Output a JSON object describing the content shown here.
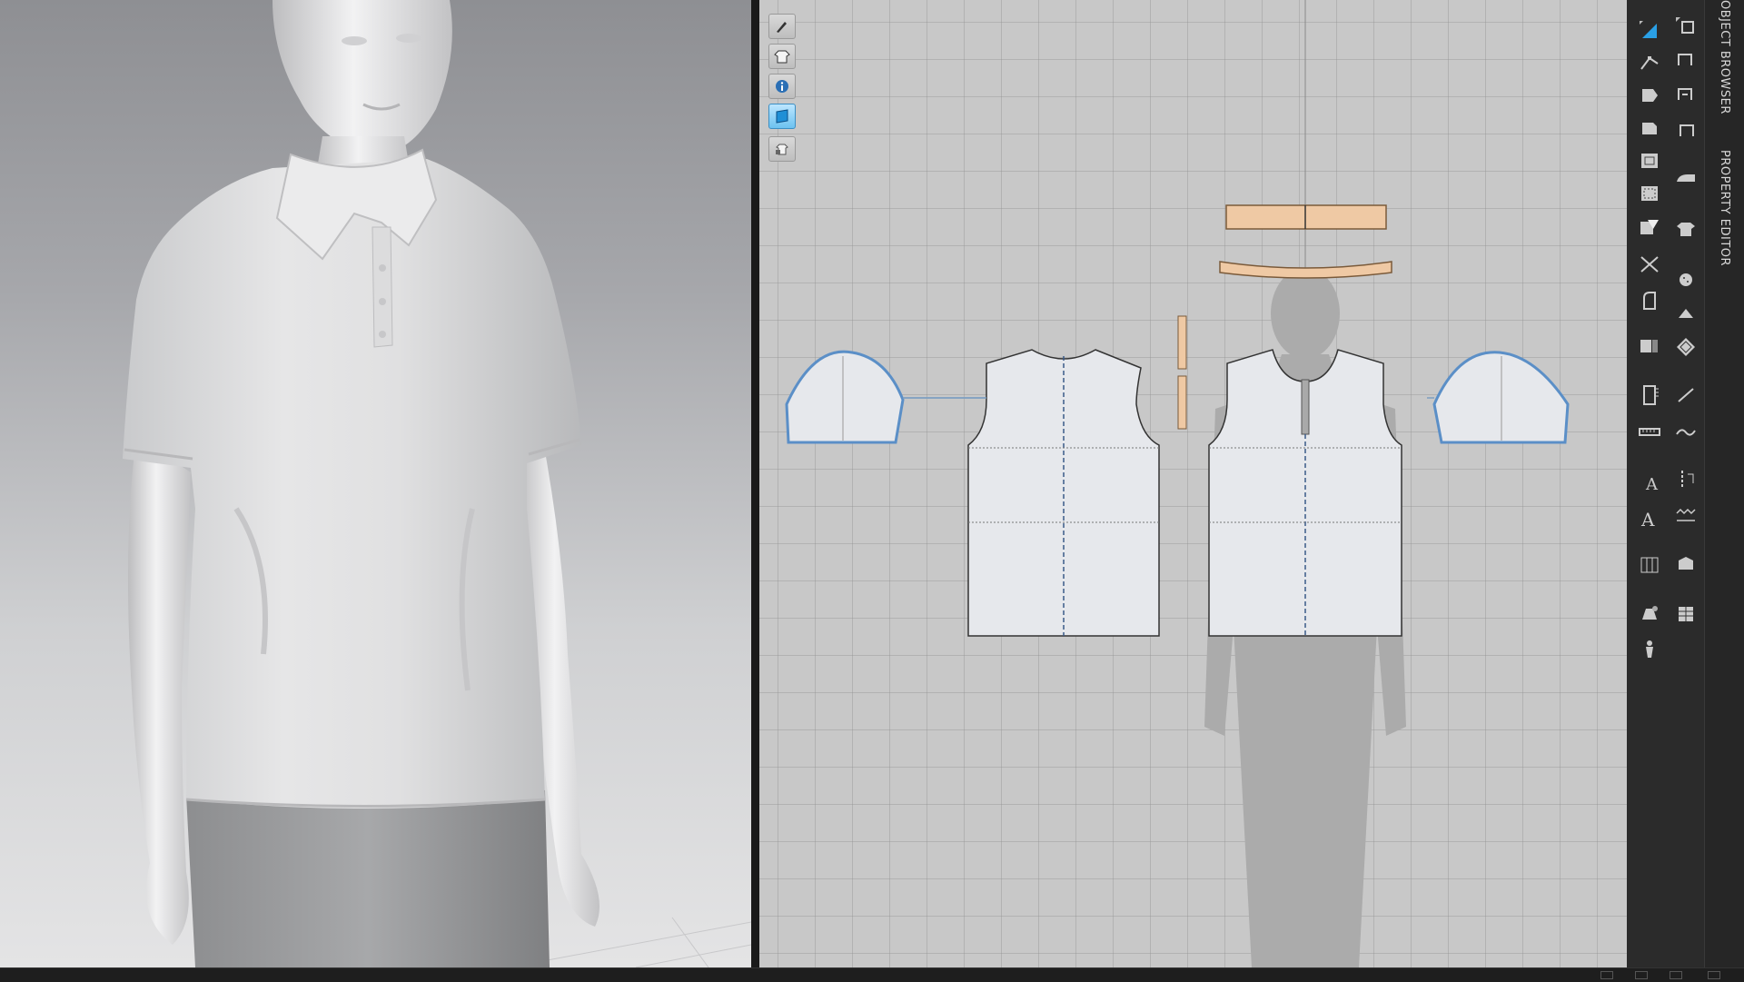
{
  "app": {
    "accent_color": "#6aa8d8",
    "fabric_color": "#e9eaee",
    "collar_color": "#f0cfae"
  },
  "viewport3d": {
    "description_icon": "avatar-polo-shirt"
  },
  "pattern_tools": [
    {
      "icon": "brush-icon",
      "active": false
    },
    {
      "icon": "shirt-icon",
      "active": false
    },
    {
      "icon": "info-icon",
      "active": false
    },
    {
      "icon": "fabric-display-icon",
      "active": true
    },
    {
      "icon": "lock-shirt-icon",
      "active": false
    }
  ],
  "side_tabs": {
    "object_browser": "OBJECT BROWSER",
    "property_editor": "PROPERTY EDITOR"
  },
  "toolbar_icons": {
    "left": [
      "transform-pattern-icon",
      "edit-point-icon",
      "polygon-icon",
      "rectangle-icon",
      "internal-polygon-icon",
      "offset-icon",
      "darts-icon",
      "cut-icon",
      "trace-icon",
      "fold-icon",
      "ruler-icon",
      "tape-icon",
      "text-tool-icon",
      "text-edit-icon",
      "grid-icon",
      "symmetric-pieces-icon",
      "avatar-pin-icon"
    ],
    "right": [
      "seam-select-icon",
      "segment-sewing-icon",
      "free-sewing-icon",
      "edit-sewing-icon",
      "iron-icon",
      "shirt-fit-icon",
      "button-icon",
      "buttonhole-icon",
      "pattern-array-icon",
      "line-tool-icon",
      "curve-tool-icon",
      "topstitch-icon",
      "zigzag-stitch-icon",
      "puckering-icon",
      "fabric-table-icon"
    ]
  }
}
